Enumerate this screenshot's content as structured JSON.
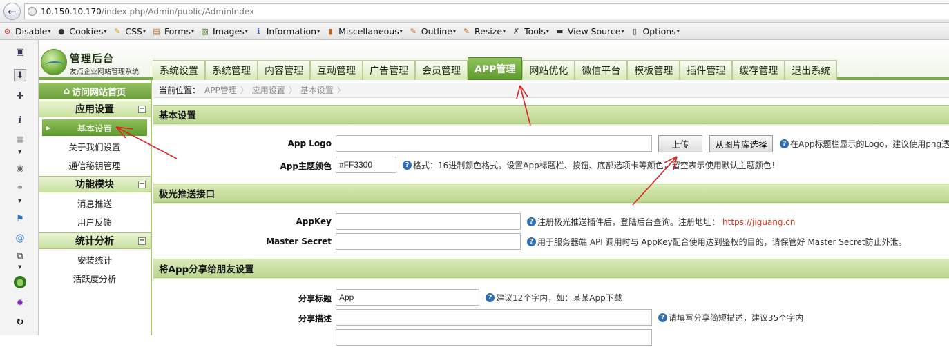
{
  "browser": {
    "url_host": "10.150.10.170",
    "url_path": "/index.php/Admin/public/AdminIndex",
    "toolbar": [
      {
        "label": "Disable",
        "icon": "disable-icon"
      },
      {
        "label": "Cookies",
        "icon": "cookies-icon"
      },
      {
        "label": "CSS",
        "icon": "css-icon"
      },
      {
        "label": "Forms",
        "icon": "forms-icon"
      },
      {
        "label": "Images",
        "icon": "images-icon"
      },
      {
        "label": "Information",
        "icon": "information-icon"
      },
      {
        "label": "Miscellaneous",
        "icon": "miscellaneous-icon"
      },
      {
        "label": "Outline",
        "icon": "outline-icon"
      },
      {
        "label": "Resize",
        "icon": "resize-icon"
      },
      {
        "label": "Tools",
        "icon": "tools-icon"
      },
      {
        "label": "View Source",
        "icon": "view-source-icon"
      },
      {
        "label": "Options",
        "icon": "options-icon"
      }
    ]
  },
  "header": {
    "logo_title": "管理后台",
    "logo_subtitle": "友点企业网站管理系统",
    "tabs": [
      {
        "label": "系统设置",
        "active": false
      },
      {
        "label": "系统管理",
        "active": false
      },
      {
        "label": "内容管理",
        "active": false
      },
      {
        "label": "互动管理",
        "active": false
      },
      {
        "label": "广告管理",
        "active": false
      },
      {
        "label": "会员管理",
        "active": false
      },
      {
        "label": "APP管理",
        "active": true
      },
      {
        "label": "网站优化",
        "active": false
      },
      {
        "label": "微信平台",
        "active": false
      },
      {
        "label": "模板管理",
        "active": false
      },
      {
        "label": "插件管理",
        "active": false
      },
      {
        "label": "缓存管理",
        "active": false
      },
      {
        "label": "退出系统",
        "active": false
      }
    ]
  },
  "sidebar": {
    "home_label": "访问网站首页",
    "sections": [
      {
        "title": "应用设置",
        "toggle": "−",
        "items": [
          {
            "label": "基本设置",
            "active": true
          },
          {
            "label": "关于我们设置",
            "active": false
          },
          {
            "label": "通信秘钥管理",
            "active": false
          }
        ]
      },
      {
        "title": "功能模块",
        "toggle": "−",
        "items": [
          {
            "label": "消息推送",
            "active": false
          },
          {
            "label": "用户反馈",
            "active": false
          }
        ]
      },
      {
        "title": "统计分析",
        "toggle": "−",
        "items": [
          {
            "label": "安装统计",
            "active": false
          },
          {
            "label": "活跃度分析",
            "active": false
          }
        ]
      }
    ]
  },
  "main": {
    "breadcrumb_lead": "当前位置：",
    "breadcrumb": [
      "APP管理",
      "应用设置",
      "基本设置"
    ],
    "basic": {
      "title": "基本设置",
      "logo_label": "App Logo",
      "logo_value": "",
      "upload_button": "上传",
      "library_button": "从图片库选择",
      "logo_hint": "在App标题栏显示的Logo，建议使用png透明",
      "color_label": "App主题颜色",
      "color_value": "#FF3300",
      "color_hint": "格式：16进制颜色格式。设置App标题栏、按钮、底部选项卡等颜色，留空表示使用默认主题颜色！"
    },
    "jpush": {
      "title": "极光推送接口",
      "appkey_label": "AppKey",
      "appkey_value": "",
      "appkey_hint": "注册极光推送插件后，登陆后台查询。注册地址：",
      "appkey_link": "https://jiguang.cn",
      "secret_label": "Master Secret",
      "secret_value": "",
      "secret_hint": "用于服务器端 API 调用时与 AppKey配合使用达到鉴权的目的，请保管好 Master Secret防止外泄。"
    },
    "share": {
      "title": "将App分享给朋友设置",
      "share_title_label": "分享标题",
      "share_title_value": "App",
      "share_title_hint": "建议12个字内，如：某某App下载",
      "share_desc_label": "分享描述",
      "share_desc_value": "",
      "share_desc_hint": "请填写分享简短描述，建议35个字内"
    }
  },
  "colors": {
    "accent_green": "#6a9d3a",
    "annotation_red": "#e02020"
  }
}
